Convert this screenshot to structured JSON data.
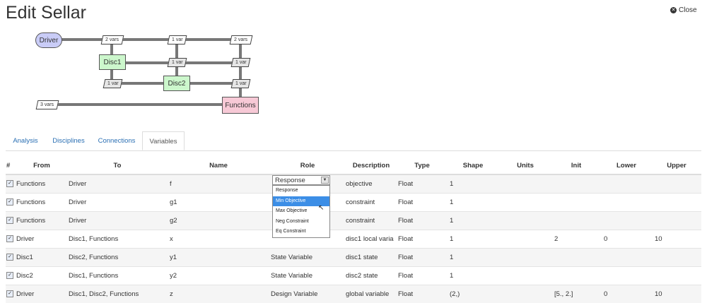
{
  "title": "Edit Sellar",
  "close_label": "Close",
  "xdsm": {
    "driver": "Driver",
    "disc1": "Disc1",
    "disc2": "Disc2",
    "functions": "Functions",
    "var_driver_disc1": "2 vars",
    "var_driver_disc2": "1 var",
    "var_driver_functions": "2 vars",
    "var_disc1_disc2": "1 var",
    "var_disc1_functions": "1 var",
    "var_disc2_disc1": "1 var",
    "var_disc2_functions": "1 var",
    "var_functions_driver": "3 vars"
  },
  "tabs": [
    "Analysis",
    "Disciplines",
    "Connections",
    "Variables"
  ],
  "table": {
    "headers": [
      "#",
      "From",
      "To",
      "Name",
      "Role",
      "Description",
      "Type",
      "Shape",
      "Units",
      "Init",
      "Lower",
      "Upper"
    ],
    "rows": [
      {
        "from": "Functions",
        "to": "Driver",
        "name": "f",
        "role": "",
        "desc": "objective",
        "type": "Float",
        "shape": "1",
        "units": "",
        "init": "",
        "lower": "",
        "upper": ""
      },
      {
        "from": "Functions",
        "to": "Driver",
        "name": "g1",
        "role": "",
        "desc": "constraint",
        "type": "Float",
        "shape": "1",
        "units": "",
        "init": "",
        "lower": "",
        "upper": ""
      },
      {
        "from": "Functions",
        "to": "Driver",
        "name": "g2",
        "role": "",
        "desc": "constraint",
        "type": "Float",
        "shape": "1",
        "units": "",
        "init": "",
        "lower": "",
        "upper": ""
      },
      {
        "from": "Driver",
        "to": "Disc1, Functions",
        "name": "x",
        "role": "",
        "desc": "disc1 local varia",
        "type": "Float",
        "shape": "1",
        "units": "",
        "init": "2",
        "lower": "0",
        "upper": "10"
      },
      {
        "from": "Disc1",
        "to": "Disc2, Functions",
        "name": "y1",
        "role": "State Variable",
        "desc": "disc1 state",
        "type": "Float",
        "shape": "1",
        "units": "",
        "init": "",
        "lower": "",
        "upper": ""
      },
      {
        "from": "Disc2",
        "to": "Disc1, Functions",
        "name": "y2",
        "role": "State Variable",
        "desc": "disc2 state",
        "type": "Float",
        "shape": "1",
        "units": "",
        "init": "",
        "lower": "",
        "upper": ""
      },
      {
        "from": "Driver",
        "to": "Disc1, Disc2, Functions",
        "name": "z",
        "role": "Design Variable",
        "desc": "global variable",
        "type": "Float",
        "shape": "(2,)",
        "units": "",
        "init": "[5., 2.]",
        "lower": "0",
        "upper": "10"
      }
    ]
  },
  "role_select": {
    "value": "Response",
    "options": [
      "Response",
      "Min Objective",
      "Max Objective",
      "Neg Constraint",
      "Eq Constraint"
    ],
    "highlighted": "Min Objective"
  }
}
